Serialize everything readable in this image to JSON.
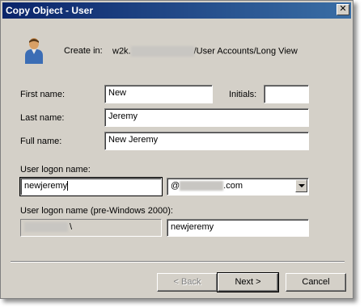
{
  "window": {
    "title": "Copy Object - User",
    "close_label": "✕"
  },
  "create_in": {
    "label": "Create in:",
    "prefix": "w2k.",
    "suffix": "/User Accounts/Long View"
  },
  "form": {
    "first_name_label": "First name:",
    "first_name_value": "New",
    "initials_label": "Initials:",
    "initials_value": "",
    "last_name_label": "Last name:",
    "last_name_value": "Jeremy",
    "full_name_label": "Full name:",
    "full_name_value": "New Jeremy",
    "logon_name_label": "User logon name:",
    "logon_name_value": "newjeremy",
    "domain_at": "@",
    "domain_suffix": ".com",
    "pre2000_label": "User logon name (pre-Windows 2000):",
    "pre2000_domain_suffix": "\\",
    "pre2000_value": "newjeremy"
  },
  "buttons": {
    "back": "< Back",
    "next": "Next >",
    "cancel": "Cancel"
  }
}
